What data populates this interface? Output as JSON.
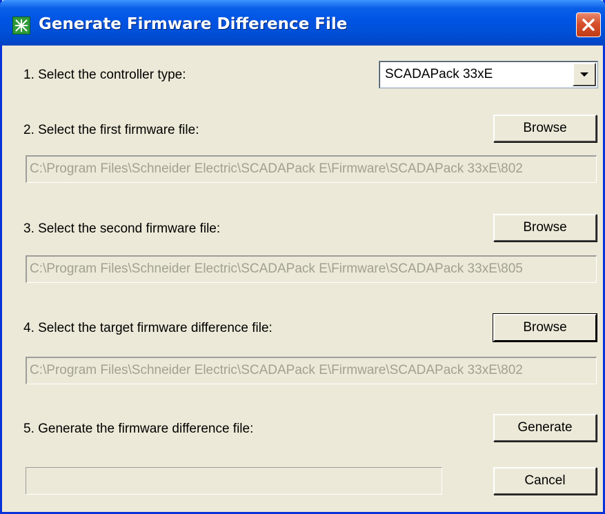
{
  "window": {
    "title": "Generate Firmware Difference File",
    "icons": {
      "app": "app-icon",
      "close": "close-icon"
    }
  },
  "step1": {
    "label": "1. Select the controller type:",
    "controller_type": "SCADAPack 33xE"
  },
  "step2": {
    "label": "2. Select the first firmware file:",
    "browse_label": "Browse",
    "path": "C:\\Program Files\\Schneider Electric\\SCADAPack E\\Firmware\\SCADAPack 33xE\\802"
  },
  "step3": {
    "label": "3. Select the second firmware file:",
    "browse_label": "Browse",
    "path": "C:\\Program Files\\Schneider Electric\\SCADAPack E\\Firmware\\SCADAPack 33xE\\805"
  },
  "step4": {
    "label": "4. Select the target firmware difference file:",
    "browse_label": "Browse",
    "path": "C:\\Program Files\\Schneider Electric\\SCADAPack E\\Firmware\\SCADAPack 33xE\\802"
  },
  "step5": {
    "label": "5. Generate the firmware difference file:",
    "generate_label": "Generate"
  },
  "footer": {
    "progress_fraction": 0,
    "cancel_label": "Cancel"
  },
  "colors": {
    "title_bar": "#0054e3",
    "window_bg": "#ece9d8",
    "close_button": "#d6502c",
    "disabled_text": "#a2a08f"
  }
}
